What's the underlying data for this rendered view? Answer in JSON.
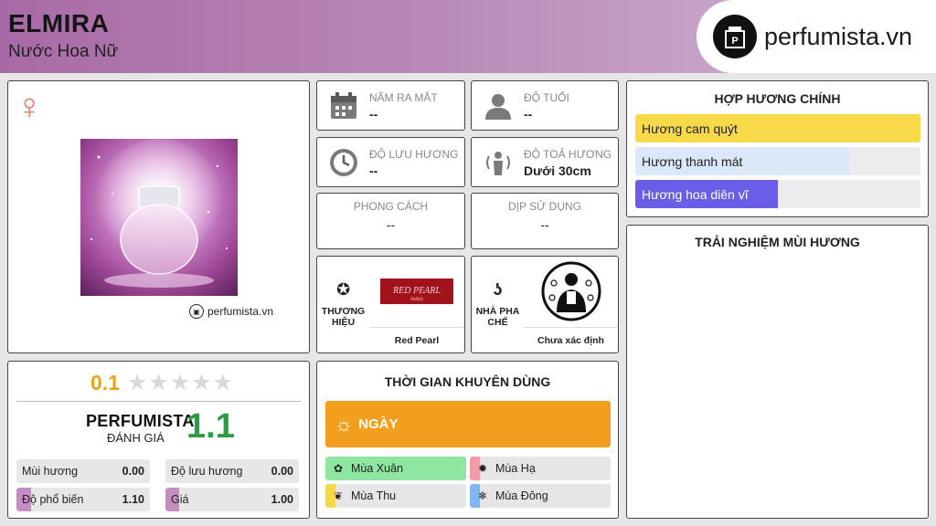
{
  "header": {
    "name": "ELMIRA",
    "subtitle": "Nước Hoa Nữ",
    "brand": "perfumista.vn"
  },
  "product": {
    "gender_icon": "female-symbol-icon",
    "watermark": "perfumista.vn"
  },
  "rating": {
    "score": "0.1",
    "stars_filled": 0,
    "stars_total": 5,
    "perfumista_label": "PERFUMISTA",
    "perfumista_sub": "ĐÁNH GIÁ",
    "perfumista_score": "1.1",
    "stats": [
      {
        "label": "Mùi hương",
        "value": "0.00",
        "fraction": 0.0
      },
      {
        "label": "Độ lưu hương",
        "value": "0.00",
        "fraction": 0.0
      },
      {
        "label": "Độ phổ biến",
        "value": "1.10",
        "fraction": 0.11
      },
      {
        "label": "Giá",
        "value": "1.00",
        "fraction": 0.1
      }
    ]
  },
  "info": {
    "release_label": "NĂM RA MẮT",
    "release_value": "--",
    "age_label": "ĐỘ TUỔI",
    "age_value": "--",
    "longevity_label": "ĐỘ LƯU HƯƠNG",
    "longevity_value": "--",
    "sillage_label": "ĐỘ TOẢ HƯƠNG",
    "sillage_value": "Dưới 30cm",
    "style_label": "PHONG CÁCH",
    "style_value": "--",
    "occasion_label": "DỊP SỬ DỤNG",
    "occasion_value": "--"
  },
  "brand_card": {
    "label": "THƯƠNG HIỆU",
    "name": "Red Pearl",
    "logo_text": "RED PEARL",
    "logo_sub": "PARIS"
  },
  "perfumer_card": {
    "label": "NHÀ PHA CHẾ",
    "name": "Chưa xác định"
  },
  "time": {
    "title": "THỜI GIAN KHUYÊN DÙNG",
    "day_label": "NGÀY",
    "seasons": [
      {
        "label": "Mùa Xuân",
        "fraction": 1.0,
        "color": "#8ee6a0"
      },
      {
        "label": "Mùa Hạ",
        "fraction": 0.07,
        "color": "#f29aa8"
      },
      {
        "label": "Mùa Thu",
        "fraction": 0.07,
        "color": "#f6d64a"
      },
      {
        "label": "Mùa Đông",
        "fraction": 0.07,
        "color": "#7fb7ee"
      }
    ]
  },
  "notes": {
    "title": "HỢP HƯƠNG CHÍNH",
    "items": [
      {
        "label": "Hương cam quýt",
        "fraction": 1.0,
        "color": "#f7d94a"
      },
      {
        "label": "Hương thanh mát",
        "fraction": 0.75,
        "color": "#dbe8fa"
      },
      {
        "label": "Hương hoa diên vĩ",
        "fraction": 0.5,
        "color": "#6a5ee8"
      }
    ]
  },
  "experience": {
    "title": "TRẢI NGHIỆM MÙI HƯƠNG"
  },
  "colors": {
    "header_gradient_start": "#a86aa6",
    "score_orange": "#e8a51a",
    "score_green": "#2a9e45",
    "day_orange": "#f29e1e"
  }
}
